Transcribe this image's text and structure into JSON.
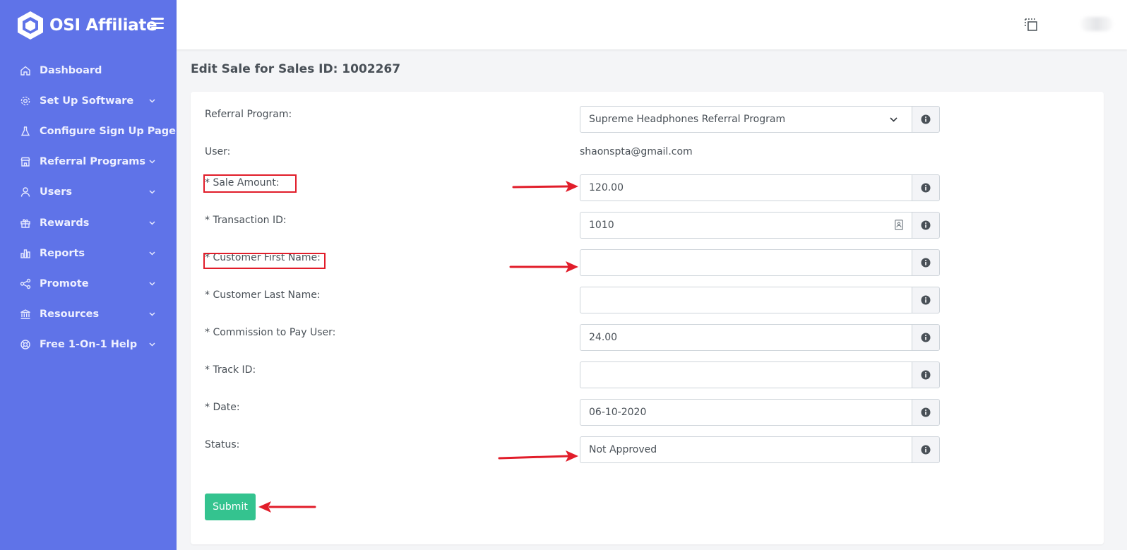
{
  "brand": {
    "name": "OSI Affiliate"
  },
  "sidebar": {
    "items": [
      {
        "label": "Dashboard",
        "icon": "home-icon",
        "has_submenu": false
      },
      {
        "label": "Set Up Software",
        "icon": "gear-icon",
        "has_submenu": true
      },
      {
        "label": "Configure Sign Up Page",
        "icon": "flask-icon",
        "has_submenu": false
      },
      {
        "label": "Referral Programs",
        "icon": "store-icon",
        "has_submenu": true
      },
      {
        "label": "Users",
        "icon": "user-icon",
        "has_submenu": true
      },
      {
        "label": "Rewards",
        "icon": "gift-icon",
        "has_submenu": true
      },
      {
        "label": "Reports",
        "icon": "bar-chart-icon",
        "has_submenu": true
      },
      {
        "label": "Promote",
        "icon": "share-icon",
        "has_submenu": true
      },
      {
        "label": "Resources",
        "icon": "bank-icon",
        "has_submenu": true
      },
      {
        "label": "Free 1-On-1 Help",
        "icon": "lifebuoy-icon",
        "has_submenu": true
      }
    ]
  },
  "page": {
    "title": "Edit Sale for Sales ID: 1002267"
  },
  "form": {
    "referral_program": {
      "label": "Referral Program:",
      "value": "Supreme Headphones Referral Program"
    },
    "user": {
      "label": "User:",
      "value": "shaonspta@gmail.com"
    },
    "sale_amount": {
      "label": "* Sale Amount:",
      "value": "120.00"
    },
    "transaction_id": {
      "label": "* Transaction ID:",
      "value": "1010"
    },
    "customer_first_name": {
      "label": "* Customer First Name:",
      "value": ""
    },
    "customer_last_name": {
      "label": "* Customer Last Name:",
      "value": ""
    },
    "commission": {
      "label": "* Commission to Pay User:",
      "value": "24.00"
    },
    "track_id": {
      "label": "* Track ID:",
      "value": ""
    },
    "date": {
      "label": "* Date:",
      "value": "06-10-2020"
    },
    "status": {
      "label": "Status:",
      "value": "Not Approved"
    },
    "submit_label": "Submit"
  },
  "colors": {
    "sidebar_bg": "#5f73e8",
    "submit_bg": "#34c38f",
    "annotation_red": "#e11d2a"
  }
}
